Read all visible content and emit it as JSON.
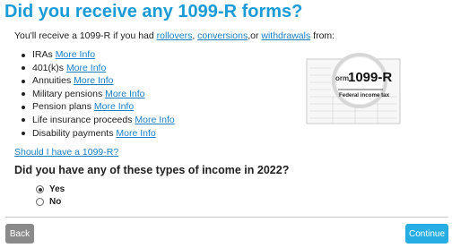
{
  "page": {
    "title": "Did you receive any 1099-R forms?"
  },
  "intro": {
    "prefix": "You'll receive a 1099-R if you had ",
    "link_rollovers": "rollovers",
    "sep1": ", ",
    "link_conversions": "conversions",
    "sep2": ",or ",
    "link_withdrawals": "withdrawals",
    "suffix": " from:"
  },
  "income_types": [
    {
      "label": "IRAs",
      "link": "More Info"
    },
    {
      "label": "401(k)s",
      "link": "More Info"
    },
    {
      "label": "Annuities",
      "link": "More Info"
    },
    {
      "label": "Military pensions",
      "link": "More Info"
    },
    {
      "label": "Pension plans",
      "link": "More Info"
    },
    {
      "label": "Life insurance proceeds",
      "link": "More Info"
    },
    {
      "label": "Disability payments",
      "link": "More Info"
    }
  ],
  "form_image": {
    "form_number": "1099-R",
    "form_prefix": "orm",
    "caption": "Federal income tax"
  },
  "should_link": "Should I have a 1099-R?",
  "question": "Did you have any of these types of income in 2022?",
  "options": {
    "yes": {
      "label": "Yes",
      "selected": true
    },
    "no": {
      "label": "No",
      "selected": false
    }
  },
  "footer": {
    "back_label": "Back",
    "continue_label": "Continue"
  },
  "colors": {
    "title": "#1a9bd7",
    "link": "#1a7fc9",
    "continue": "#26aee4",
    "back": "#8a8a8a"
  }
}
